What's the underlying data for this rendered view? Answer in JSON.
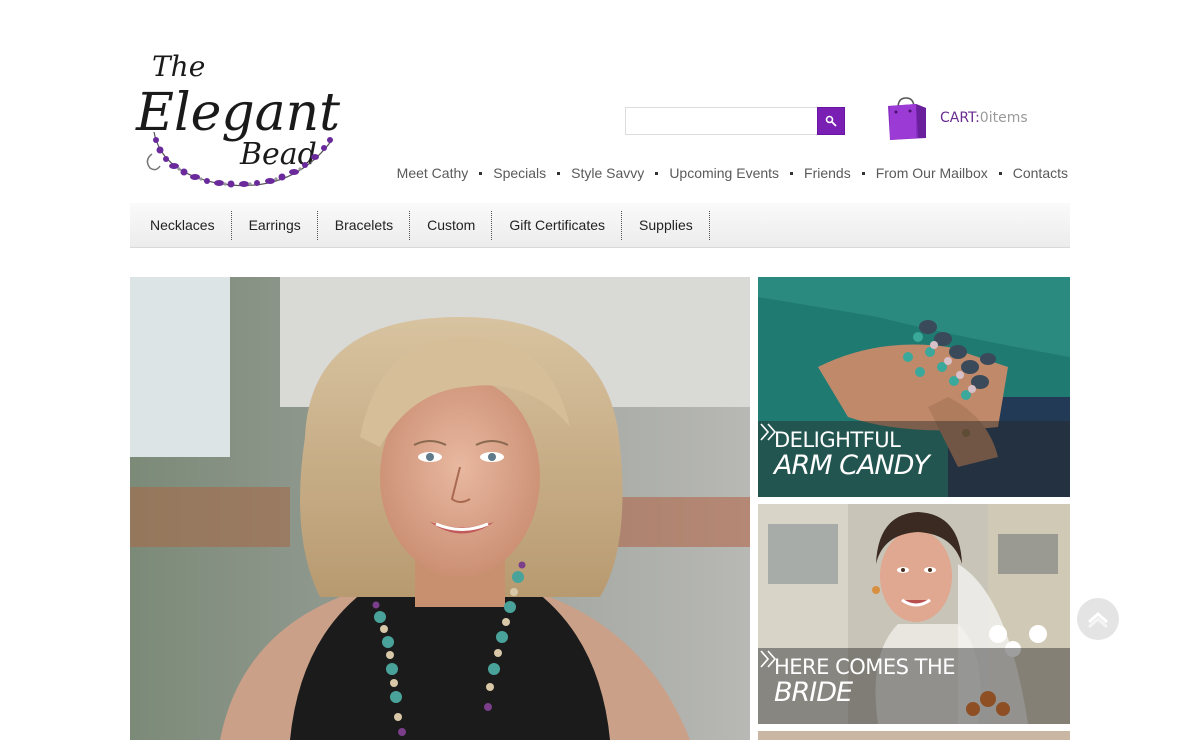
{
  "brand": {
    "name_line1": "The",
    "name_line2": "Elegant",
    "name_line3": "Bead"
  },
  "search": {
    "placeholder": "",
    "value": "",
    "button_icon": "search-icon"
  },
  "cart": {
    "label": "CART:",
    "count_text": "0items",
    "icon": "shopping-bag-icon"
  },
  "top_nav": [
    {
      "label": "Meet Cathy"
    },
    {
      "label": "Specials"
    },
    {
      "label": "Style Savvy"
    },
    {
      "label": "Upcoming Events"
    },
    {
      "label": "Friends"
    },
    {
      "label": "From Our Mailbox"
    },
    {
      "label": "Contacts"
    }
  ],
  "categories": [
    {
      "label": "Necklaces"
    },
    {
      "label": "Earrings"
    },
    {
      "label": "Bracelets"
    },
    {
      "label": "Custom"
    },
    {
      "label": "Gift Certificates"
    },
    {
      "label": "Supplies"
    }
  ],
  "promos": [
    {
      "line1": "DELIGHTFUL",
      "line2": "ARM CANDY"
    },
    {
      "line1": "HERE COMES THE",
      "line2": "BRIDE"
    }
  ],
  "colors": {
    "accent": "#7a1fb3",
    "cart_text": "#6a2c91",
    "nav_text": "#5a5a5a"
  }
}
